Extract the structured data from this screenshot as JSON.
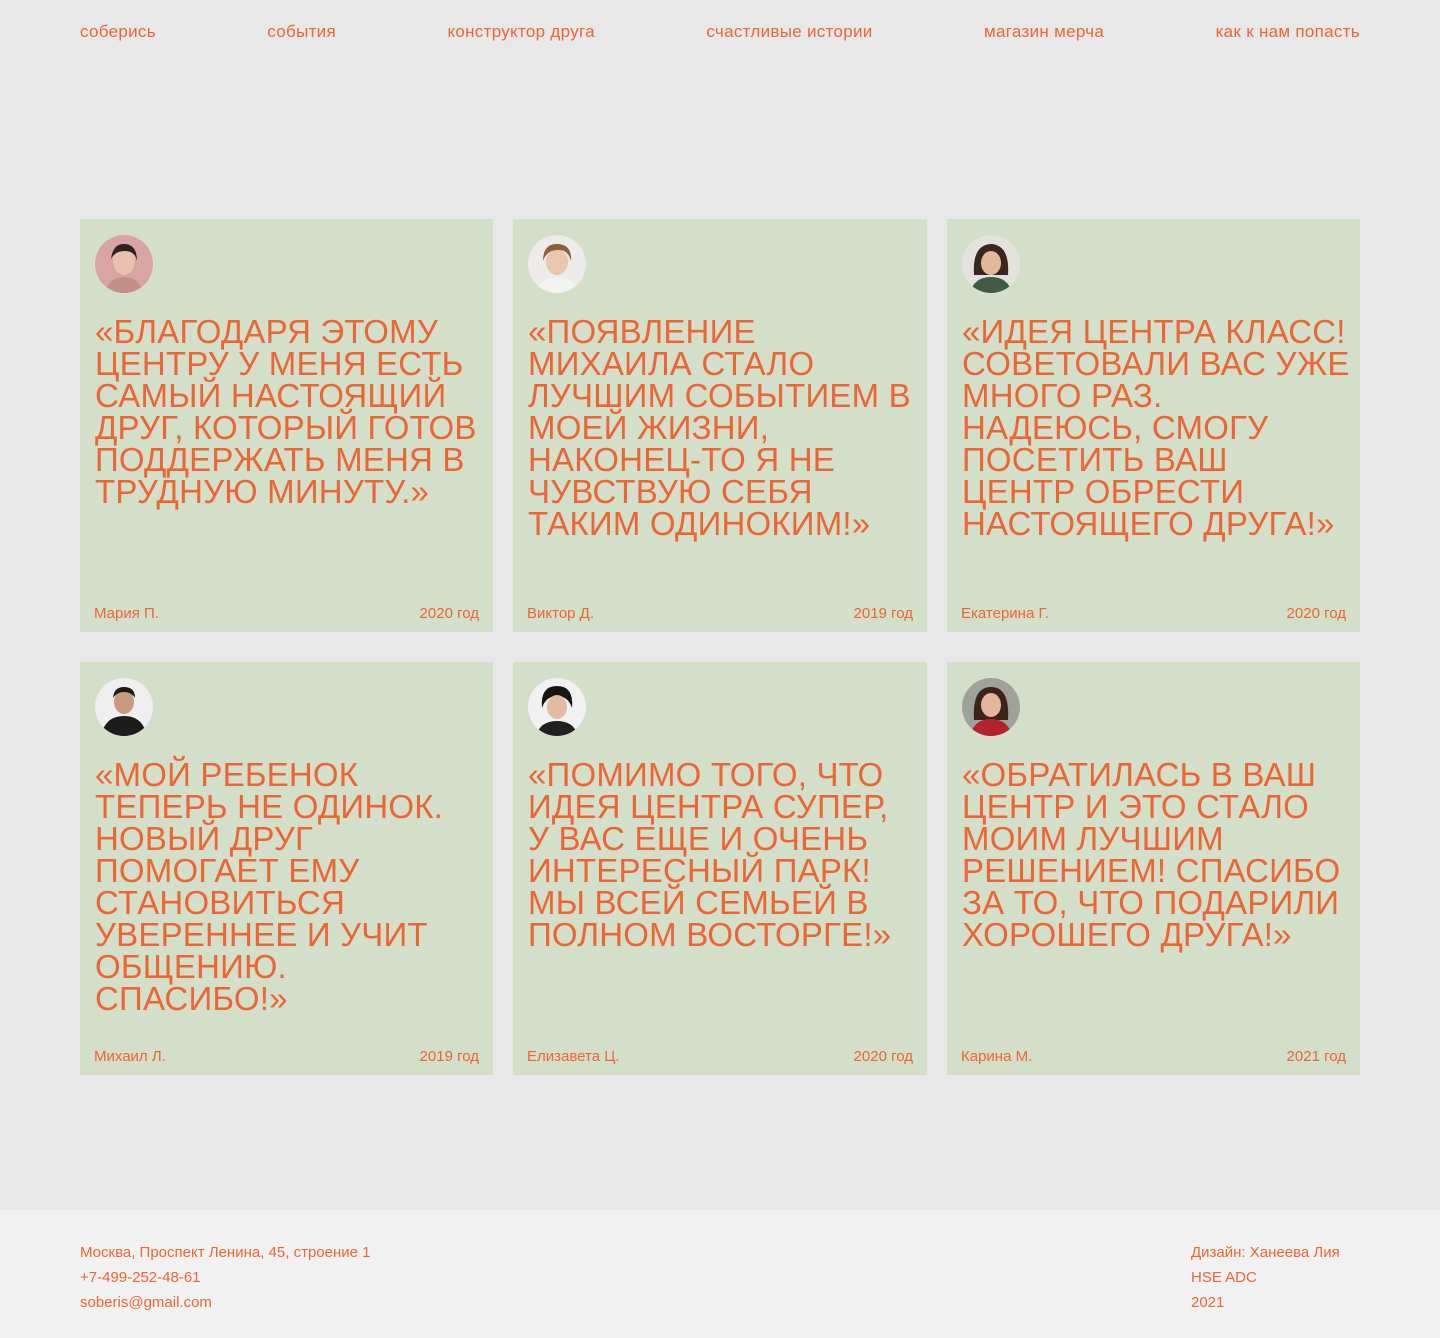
{
  "nav": {
    "items": [
      {
        "label": "соберись"
      },
      {
        "label": "события"
      },
      {
        "label": "конструктор друга"
      },
      {
        "label": "счастливые истории"
      },
      {
        "label": "магазин мерча"
      },
      {
        "label": "как к нам попасть"
      }
    ]
  },
  "colors": {
    "accent": "#ec6535",
    "background": "#e8e8e8",
    "card": "#d3dfc8",
    "footer": "#f1f1f1"
  },
  "testimonials": [
    {
      "quote": "«Благодаря этому центру у меня есть самый настоящий друг, который готов поддержать меня в трудную минуту.»",
      "author": "Мария П.",
      "year": "2020 год",
      "avatar_icon": "avatar-woman-photo"
    },
    {
      "quote": "«Появление Михаила стало лучшим событием в моей жизни, наконец-то я не чувствую себя таким одиноким!»",
      "author": "Виктор Д.",
      "year": "2019 год",
      "avatar_icon": "avatar-man-photo"
    },
    {
      "quote": "«Идея центра класс! Советовали вас уже много раз. Надеюсь, смогу посетить ваш центр обрести настоящего друга!»",
      "author": "Екатерина Г.",
      "year": "2020 год",
      "avatar_icon": "avatar-woman-photo"
    },
    {
      "quote": "«Мой ребенок теперь не одинок. Новый друг помогает ему становиться увереннее и учит общению. Спасибо!»",
      "author": "Михаил Л.",
      "year": "2019 год",
      "avatar_icon": "avatar-man-photo"
    },
    {
      "quote": "«Помимо того, что идея центра супер, у вас еще и очень интересный парк! Мы всей семьей в полном восторге!»",
      "author": "Елизавета Ц.",
      "year": "2020 год",
      "avatar_icon": "avatar-woman-photo"
    },
    {
      "quote": "«Обратилась в ваш центр и это стало моим лучшим решением! Спасибо за то, что подарили хорошего друга!»",
      "author": "Карина М.",
      "year": "2021 год",
      "avatar_icon": "avatar-woman-photo"
    }
  ],
  "footer": {
    "address": "Москва, Проспект Ленина, 45, строение 1",
    "phone": "+7-499-252-48-61",
    "email": "soberis@gmail.com",
    "design_credit": "Дизайн: Ханеева Лия",
    "school": "HSE ADC",
    "year": "2021"
  }
}
